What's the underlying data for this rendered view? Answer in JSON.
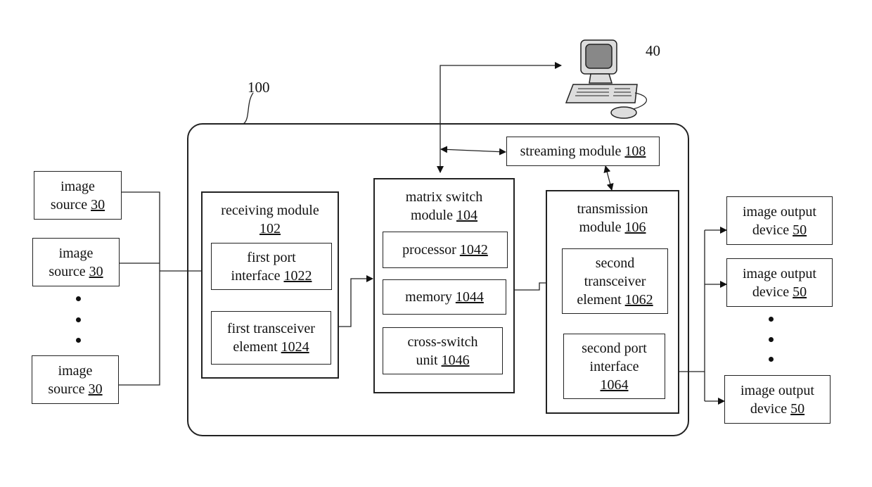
{
  "figure": {
    "device_ref": "100",
    "computer_ref": "40"
  },
  "image_sources": [
    {
      "text": "image",
      "text2": "source ",
      "ref": "30"
    },
    {
      "text": "image",
      "text2": "source ",
      "ref": "30"
    },
    {
      "text": "image",
      "text2": "source ",
      "ref": "30"
    }
  ],
  "receiving_module": {
    "title": "receiving module",
    "ref": "102",
    "first_port": {
      "line1": "first port",
      "line2": "interface ",
      "ref": "1022"
    },
    "first_transceiver": {
      "line1": "first transceiver",
      "line2": "element ",
      "ref": "1024"
    }
  },
  "matrix_switch_module": {
    "line1": "matrix switch",
    "line2": "module ",
    "ref": "104",
    "processor": {
      "label": "processor ",
      "ref": "1042"
    },
    "memory": {
      "label": "memory ",
      "ref": "1044"
    },
    "cross_switch": {
      "line1": "cross-switch",
      "line2": "unit ",
      "ref": "1046"
    }
  },
  "streaming_module": {
    "label": "streaming module ",
    "ref": "108"
  },
  "transmission_module": {
    "line1": "transmission",
    "line2": "module ",
    "ref": "106",
    "second_transceiver": {
      "line1": "second",
      "line2": "transceiver",
      "line3": "element ",
      "ref": "1062"
    },
    "second_port": {
      "line1": "second port",
      "line2": "interface",
      "ref": "1064"
    }
  },
  "image_output_devices": [
    {
      "line1": "image output",
      "line2": "device ",
      "ref": "50"
    },
    {
      "line1": "image output",
      "line2": "device ",
      "ref": "50"
    },
    {
      "line1": "image output",
      "line2": "device ",
      "ref": "50"
    }
  ]
}
